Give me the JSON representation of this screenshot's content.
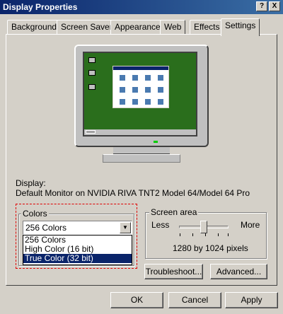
{
  "window": {
    "title": "Display Properties",
    "help_button": "?",
    "close_button": "X"
  },
  "tabs": [
    {
      "label": "Background"
    },
    {
      "label": "Screen Saver"
    },
    {
      "label": "Appearance"
    },
    {
      "label": "Web"
    },
    {
      "label": "Effects"
    },
    {
      "label": "Settings",
      "active": true
    }
  ],
  "preview": {
    "screen_color": "#2a6e1c"
  },
  "display": {
    "label": "Display:",
    "device": "Default Monitor on NVIDIA RIVA TNT2 Model 64/Model 64 Pro"
  },
  "colors": {
    "group_title": "Colors",
    "selected_value": "256 Colors",
    "options": [
      {
        "label": "256 Colors"
      },
      {
        "label": "High Color (16 bit)"
      },
      {
        "label": "True Color (32 bit)",
        "highlighted": true
      }
    ]
  },
  "screen_area": {
    "group_title": "Screen area",
    "less_label": "Less",
    "more_label": "More",
    "resolution_text": "1280 by 1024 pixels",
    "slider_level": 0.5
  },
  "buttons": {
    "troubleshoot": "Troubleshoot...",
    "advanced": "Advanced...",
    "ok": "OK",
    "cancel": "Cancel",
    "apply": "Apply"
  }
}
